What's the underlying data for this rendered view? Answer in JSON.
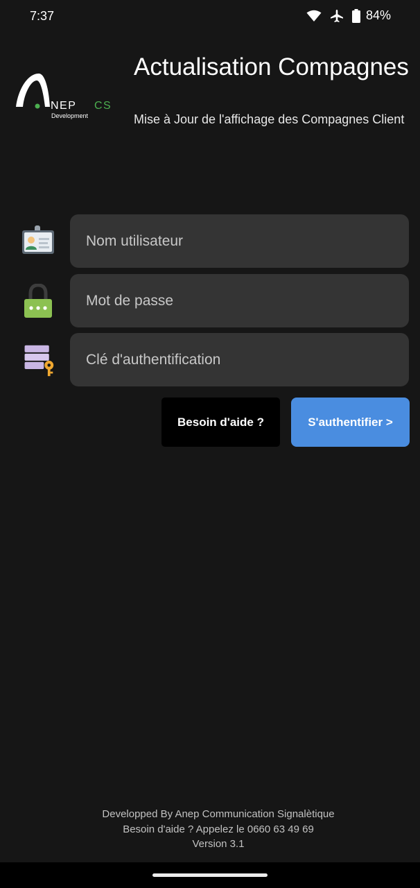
{
  "status_bar": {
    "time": "7:37",
    "battery_percent": "84%",
    "icons": [
      "wifi-icon",
      "airplane-mode-icon",
      "battery-icon"
    ]
  },
  "header": {
    "logo_text": "ANEP CS",
    "logo_subtext": "Development",
    "title": "Actualisation Compagnes",
    "subtitle": "Mise à Jour de l'affichage des Compagnes Client"
  },
  "form": {
    "username_placeholder": "Nom utilisateur",
    "password_placeholder": "Mot de passe",
    "auth_key_placeholder": "Clé d'authentification",
    "icons": [
      "id-card-icon",
      "lock-icon",
      "server-key-icon"
    ]
  },
  "actions": {
    "help_label": "Besoin d'aide ?",
    "authenticate_label": "S'authentifier >"
  },
  "footer": {
    "line1": "Developped By Anep Communication Signalètique",
    "line2": "Besoin d'aide ? Appelez le 0660 63 49 69",
    "line3": "Version 3.1"
  },
  "colors": {
    "background": "#161616",
    "field_background": "#343434",
    "accent_blue": "#4a8de0",
    "logo_green": "#4caf50"
  }
}
